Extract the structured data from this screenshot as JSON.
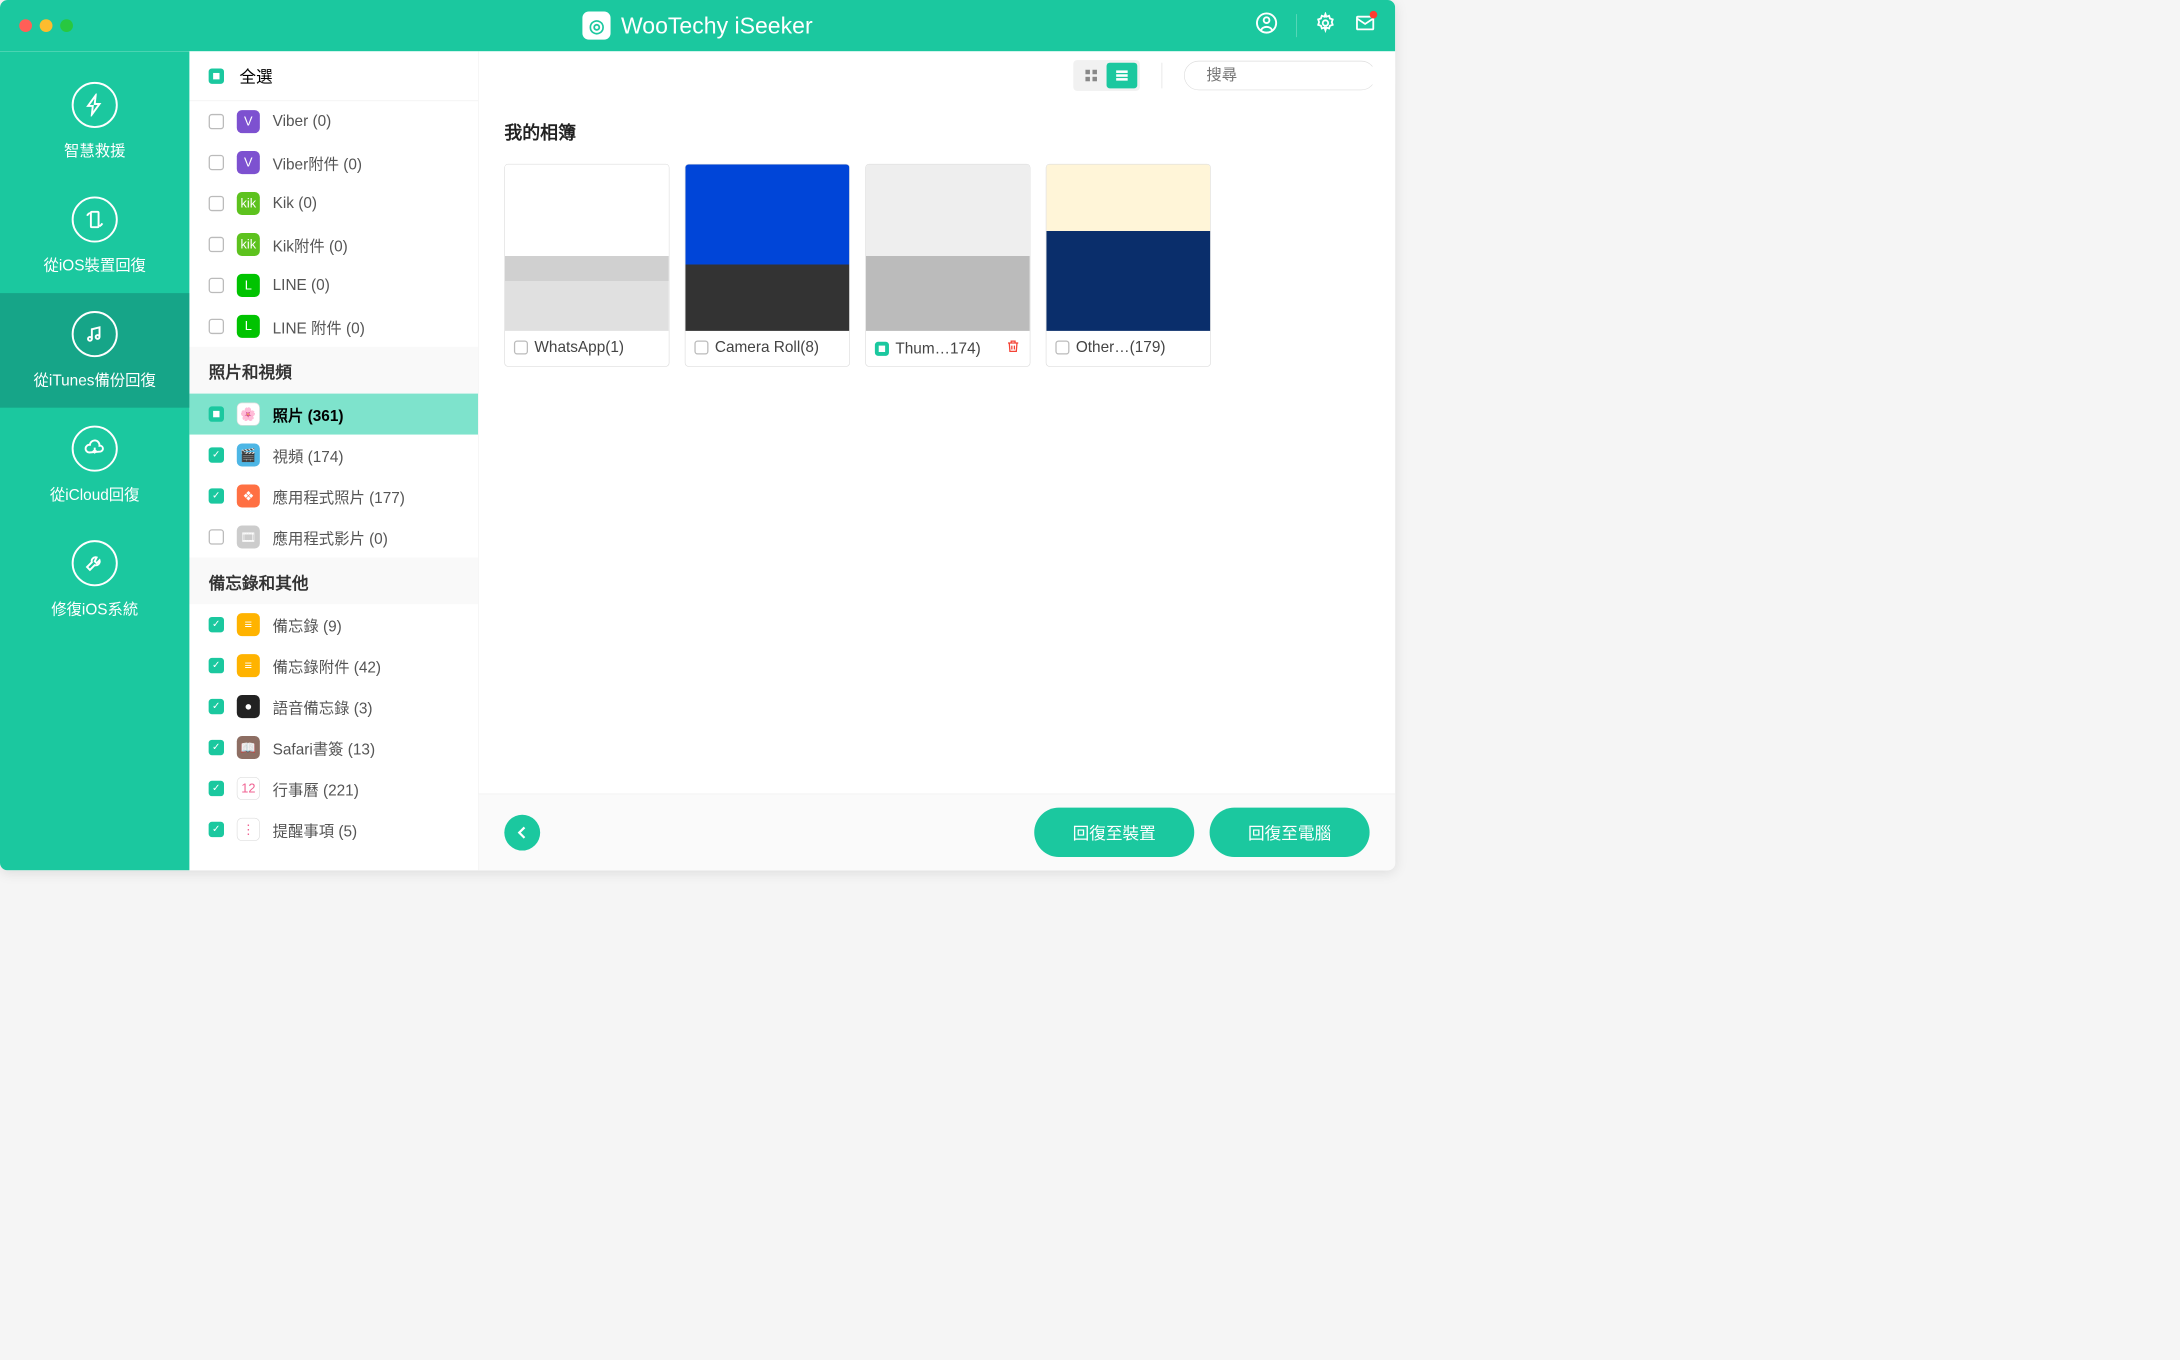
{
  "app": {
    "title": "WooTechy iSeeker"
  },
  "sidebar": {
    "items": [
      {
        "label": "智慧救援"
      },
      {
        "label": "從iOS裝置回復"
      },
      {
        "label": "從iTunes備份回復"
      },
      {
        "label": "從iCloud回復"
      },
      {
        "label": "修復iOS系統"
      }
    ]
  },
  "listpane": {
    "select_all": "全選",
    "groups": [
      {
        "items": [
          {
            "label": "Viber (0)",
            "icon": "V",
            "color": "#7d51d0",
            "checked": false
          },
          {
            "label": "Viber附件 (0)",
            "icon": "V",
            "color": "#7d51d0",
            "checked": false
          },
          {
            "label": "Kik (0)",
            "icon": "kik",
            "color": "#5dc21e",
            "checked": false
          },
          {
            "label": "Kik附件 (0)",
            "icon": "kik",
            "color": "#5dc21e",
            "checked": false
          },
          {
            "label": "LINE (0)",
            "icon": "L",
            "color": "#00c300",
            "checked": false
          },
          {
            "label": "LINE 附件 (0)",
            "icon": "L",
            "color": "#00c300",
            "checked": false
          }
        ]
      },
      {
        "header": "照片和視頻",
        "items": [
          {
            "label": "照片 (361)",
            "icon": "🌸",
            "color": "#fff",
            "checked": "partial",
            "selected": true
          },
          {
            "label": "視頻 (174)",
            "icon": "🎬",
            "color": "#4db6e5",
            "checked": true
          },
          {
            "label": "應用程式照片 (177)",
            "icon": "❖",
            "color": "#ff7043",
            "checked": true
          },
          {
            "label": "應用程式影片 (0)",
            "icon": "🎞",
            "color": "#ccc",
            "checked": false
          }
        ]
      },
      {
        "header": "備忘錄和其他",
        "items": [
          {
            "label": "備忘錄 (9)",
            "icon": "≡",
            "color": "#ffb300",
            "checked": true
          },
          {
            "label": "備忘錄附件 (42)",
            "icon": "≡",
            "color": "#ffb300",
            "checked": true
          },
          {
            "label": "語音備忘錄 (3)",
            "icon": "●",
            "color": "#222",
            "checked": true
          },
          {
            "label": "Safari書簽 (13)",
            "icon": "📖",
            "color": "#8d6e63",
            "checked": true
          },
          {
            "label": "行事曆 (221)",
            "icon": "12",
            "color": "#fff",
            "checked": true
          },
          {
            "label": "提醒事項 (5)",
            "icon": "⋮",
            "color": "#fff",
            "checked": true
          }
        ]
      }
    ]
  },
  "content": {
    "title": "我的相簿",
    "search_placeholder": "搜尋",
    "albums": [
      {
        "label": "WhatsApp(1)",
        "checked": false,
        "thumb": "thumb1"
      },
      {
        "label": "Camera Roll(8)",
        "checked": false,
        "thumb": "thumb2"
      },
      {
        "label": "Thum…174)",
        "checked": "partial",
        "trash": true,
        "thumb": "thumb3"
      },
      {
        "label": "Other…(179)",
        "checked": false,
        "thumb": "thumb4"
      }
    ]
  },
  "actions": {
    "recover_device": "回復至裝置",
    "recover_pc": "回復至電腦"
  }
}
